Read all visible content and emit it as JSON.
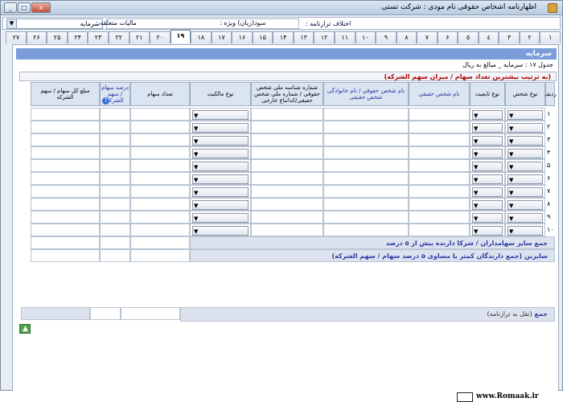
{
  "window": {
    "title": "اظهارنامه اشخاص حقوقی   نام مودی : شرکت تستی",
    "buttons": [
      "_",
      "□",
      "x"
    ]
  },
  "header": {
    "capital_select": "سرمایه",
    "declaration_diff_label": "اختلاف ترازنامه :",
    "special_profit_label": "سود(زيان) ويژه :",
    "tax_label": "ماليات متعلقه :"
  },
  "tabs": [
    "١",
    "٢",
    "٣",
    "٤",
    "٥",
    "۶",
    "٧",
    "٨",
    "٩",
    "١٠",
    "١١",
    "١٢",
    "١٣",
    "١۴",
    "١۵",
    "١۶",
    "١٧",
    "١٨",
    "١٩",
    "٢٠",
    "٢١",
    "٢٢",
    "٢٣",
    "٢۴",
    "٢۵",
    "٢۶",
    "٢٧"
  ],
  "active_tab_index": 18,
  "section": {
    "title": "سرمایه",
    "subtitle": "جدول ١٧ : سرمایه _ مبالغ به ریال",
    "red_note": "(به ترتیب بیشترین تعداد سهام / میزان سهم الشرکه)"
  },
  "columns": {
    "row": "ردیف",
    "person_type": "نوع شخص",
    "nationality": "نوع تابعیت",
    "natural_name": "نام شخص حقیقی",
    "legal_name": "نام شخص حقوقی / نام خانوادگی شخص حقیقی",
    "national_id": "شماره شناسه ملی شخص حقوقی / شماره ملی شخص حقیقی/کداتباع خارجی",
    "ownership": "نوع مالکیت",
    "share_count": "تعداد سهام",
    "share_percent": "درصد سهام / سهم الشرکه",
    "share_amount": "مبلغ کل سهام / سهم الشرکه"
  },
  "rows": [
    "١",
    "٢",
    "٣",
    "۴",
    "۵",
    "۶",
    "٧",
    "٨",
    "٩",
    "١٠"
  ],
  "summary": {
    "other_over5": "جمع سایر سهامداران / شرکا دارنده بیش از ۵ درصد",
    "others_under5": "سایرین (جمع دارندگان کمتر یا مساوی ۵ درصد سهام / سهم الشرکه)",
    "total_label": "جمع",
    "total_note": "(نقل به ترازنامه)"
  },
  "footer": {
    "brand": "www.Romaak.ir"
  }
}
